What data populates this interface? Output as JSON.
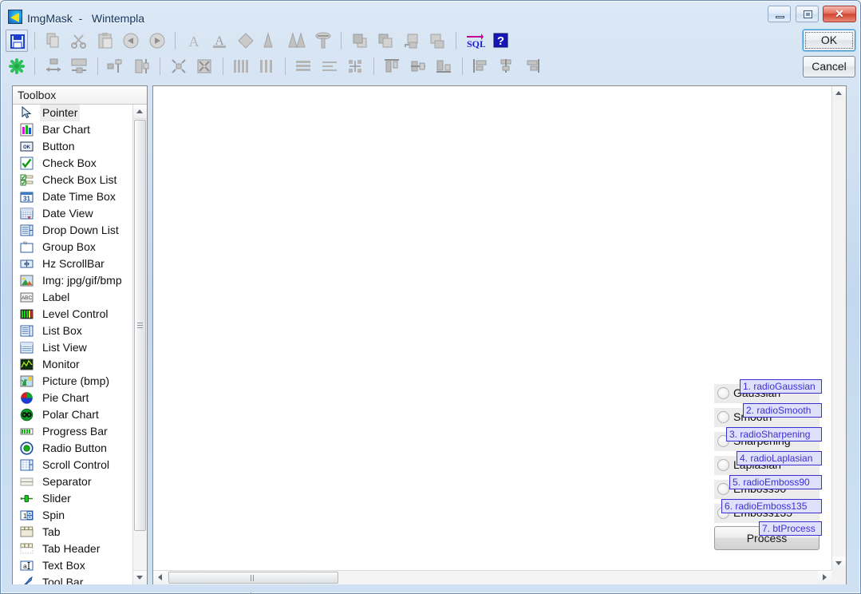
{
  "window": {
    "title": "ImgMask  -   Wintempla",
    "app_icon": "imgmask-app-icon",
    "controls": {
      "minimize": "minimize-icon",
      "maximize": "maximize-icon",
      "close": "close-icon"
    }
  },
  "dialog_buttons": {
    "ok": "OK",
    "cancel": "Cancel"
  },
  "toolbar": {
    "row1": [
      {
        "name": "save-icon",
        "state": "active"
      },
      {
        "name": "separator"
      },
      {
        "name": "copy-icon",
        "state": "disabled"
      },
      {
        "name": "cut-icon",
        "state": "disabled"
      },
      {
        "name": "paste-icon",
        "state": "disabled"
      },
      {
        "name": "undo-icon",
        "state": "disabled"
      },
      {
        "name": "redo-icon",
        "state": "disabled"
      },
      {
        "name": "separator"
      },
      {
        "name": "font-icon",
        "state": "disabled"
      },
      {
        "name": "font-color-icon",
        "state": "disabled"
      },
      {
        "name": "fill-color-icon",
        "state": "disabled"
      },
      {
        "name": "pen-icon",
        "state": "disabled"
      },
      {
        "name": "pen2-icon",
        "state": "disabled"
      },
      {
        "name": "screw-icon",
        "state": "disabled"
      },
      {
        "name": "separator"
      },
      {
        "name": "bring-to-front-icon",
        "state": "disabled"
      },
      {
        "name": "send-to-back-icon",
        "state": "disabled"
      },
      {
        "name": "bring-forward-icon",
        "state": "disabled"
      },
      {
        "name": "send-backward-icon",
        "state": "disabled"
      },
      {
        "name": "separator"
      },
      {
        "name": "sql-icon",
        "state": "active"
      },
      {
        "name": "help-icon",
        "state": "active"
      }
    ],
    "row2": [
      {
        "name": "snowflake-icon",
        "state": "active"
      },
      {
        "name": "separator"
      },
      {
        "name": "make-same-width-icon",
        "state": "disabled"
      },
      {
        "name": "make-same-height-icon",
        "state": "disabled"
      },
      {
        "name": "separator"
      },
      {
        "name": "size-to-grid-icon",
        "state": "disabled"
      },
      {
        "name": "size-to-fit-icon",
        "state": "disabled"
      },
      {
        "name": "separator"
      },
      {
        "name": "horizontal-spacing-decrease-icon",
        "state": "disabled"
      },
      {
        "name": "horizontal-spacing-remove-icon",
        "state": "disabled"
      },
      {
        "name": "separator"
      },
      {
        "name": "vertical-spacing-make-equal-icon",
        "state": "disabled"
      },
      {
        "name": "vertical-spacing-increase-icon",
        "state": "disabled"
      },
      {
        "name": "separator"
      },
      {
        "name": "align-lefts-icon",
        "state": "disabled"
      },
      {
        "name": "align-centers-icon",
        "state": "disabled"
      },
      {
        "name": "align-grid-icon",
        "state": "disabled"
      },
      {
        "name": "separator"
      },
      {
        "name": "align-tops-icon",
        "state": "disabled"
      },
      {
        "name": "align-middles-icon",
        "state": "disabled"
      },
      {
        "name": "align-bottoms-icon",
        "state": "disabled"
      },
      {
        "name": "separator"
      },
      {
        "name": "order-left-icon",
        "state": "disabled"
      },
      {
        "name": "order-center-icon",
        "state": "disabled"
      },
      {
        "name": "order-right-icon",
        "state": "disabled"
      }
    ]
  },
  "toolbox": {
    "header": "Toolbox",
    "items": [
      {
        "label": "Pointer",
        "icon": "pointer-icon",
        "selected": true
      },
      {
        "label": "Bar Chart",
        "icon": "bar-chart-icon",
        "selected": false
      },
      {
        "label": "Button",
        "icon": "button-icon",
        "selected": false
      },
      {
        "label": "Check Box",
        "icon": "check-box-icon",
        "selected": false
      },
      {
        "label": "Check Box List",
        "icon": "check-box-list-icon",
        "selected": false
      },
      {
        "label": "Date Time Box",
        "icon": "date-time-box-icon",
        "selected": false
      },
      {
        "label": "Date View",
        "icon": "date-view-icon",
        "selected": false
      },
      {
        "label": "Drop Down List",
        "icon": "drop-down-list-icon",
        "selected": false
      },
      {
        "label": "Group Box",
        "icon": "group-box-icon",
        "selected": false
      },
      {
        "label": "Hz ScrollBar",
        "icon": "hz-scrollbar-icon",
        "selected": false
      },
      {
        "label": "Img: jpg/gif/bmp",
        "icon": "image-icon",
        "selected": false
      },
      {
        "label": "Label",
        "icon": "label-icon",
        "selected": false
      },
      {
        "label": "Level Control",
        "icon": "level-control-icon",
        "selected": false
      },
      {
        "label": "List Box",
        "icon": "list-box-icon",
        "selected": false
      },
      {
        "label": "List View",
        "icon": "list-view-icon",
        "selected": false
      },
      {
        "label": "Monitor",
        "icon": "monitor-icon",
        "selected": false
      },
      {
        "label": "Picture (bmp)",
        "icon": "picture-icon",
        "selected": false
      },
      {
        "label": "Pie Chart",
        "icon": "pie-chart-icon",
        "selected": false
      },
      {
        "label": "Polar Chart",
        "icon": "polar-chart-icon",
        "selected": false
      },
      {
        "label": "Progress Bar",
        "icon": "progress-bar-icon",
        "selected": false
      },
      {
        "label": "Radio Button",
        "icon": "radio-button-icon",
        "selected": false
      },
      {
        "label": "Scroll Control",
        "icon": "scroll-control-icon",
        "selected": false
      },
      {
        "label": "Separator",
        "icon": "separator-icon",
        "selected": false
      },
      {
        "label": "Slider",
        "icon": "slider-icon",
        "selected": false
      },
      {
        "label": "Spin",
        "icon": "spin-icon",
        "selected": false
      },
      {
        "label": "Tab",
        "icon": "tab-icon",
        "selected": false
      },
      {
        "label": "Tab Header",
        "icon": "tab-header-icon",
        "selected": false
      },
      {
        "label": "Text Box",
        "icon": "text-box-icon",
        "selected": false
      },
      {
        "label": "Tool Bar",
        "icon": "tool-bar-icon",
        "selected": false
      }
    ]
  },
  "designer": {
    "controls": [
      {
        "type": "radio",
        "label": "Gaussian",
        "tag": "1. radioGaussian"
      },
      {
        "type": "radio",
        "label": "Smooth",
        "tag": "2. radioSmooth"
      },
      {
        "type": "radio",
        "label": "Sharpening",
        "tag": "3. radioSharpening"
      },
      {
        "type": "radio",
        "label": "Laplasian",
        "tag": "4. radioLaplasian"
      },
      {
        "type": "radio",
        "label": "Emboss90",
        "tag": "5. radioEmboss90"
      },
      {
        "type": "radio",
        "label": "Emboss135",
        "tag": "6. radioEmboss135"
      },
      {
        "type": "button",
        "label": "Process",
        "tag": "7. btProcess"
      }
    ]
  },
  "colors": {
    "tag_border": "#3b2fd4",
    "tag_bg": "#dfe0fb",
    "title_accent": "#12335c",
    "close_button": "#d2432f"
  }
}
